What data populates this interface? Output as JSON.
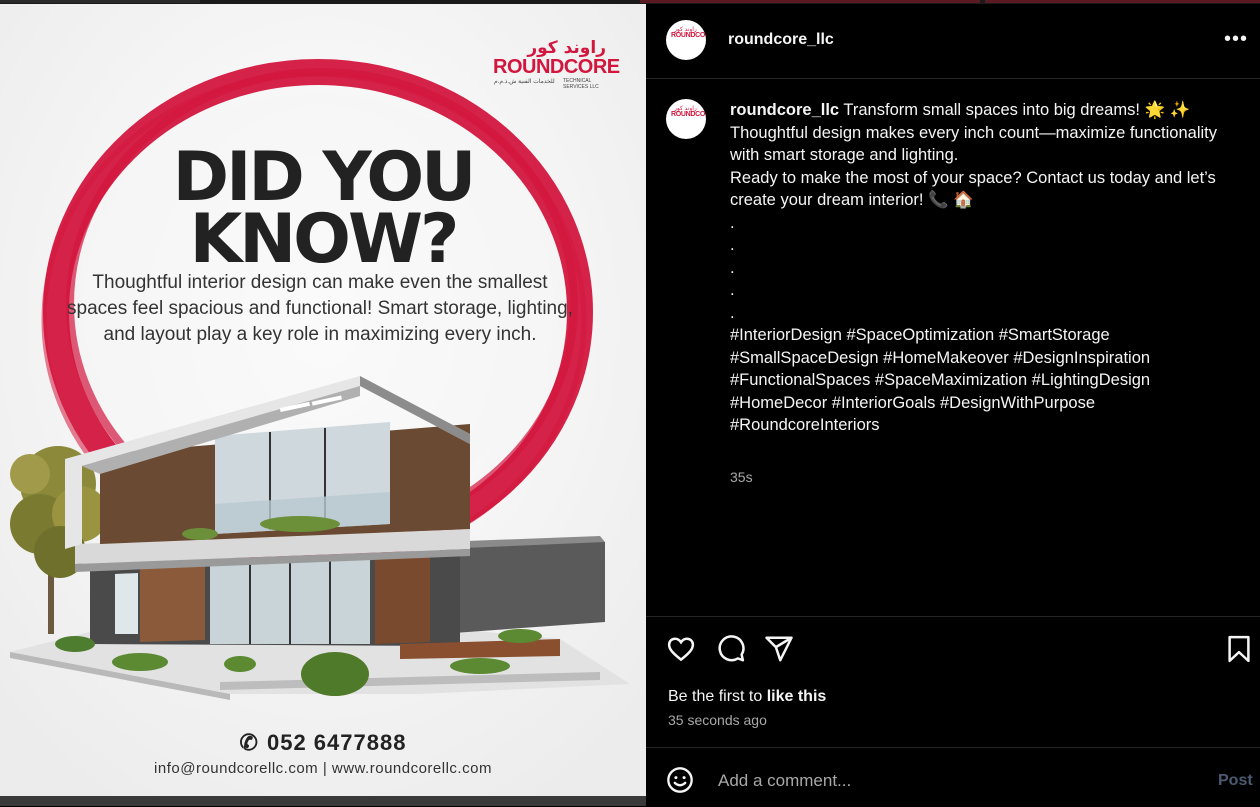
{
  "poster": {
    "logo_arabic": "راوند كور",
    "logo_round": "ROUND",
    "logo_core": "CORE",
    "logo_sub_arabic": "للخدمات الفنية ش.ذ.م.م",
    "logo_sub_english": "TECHNICAL SERVICES LLC",
    "headline_line1": "DID YOU",
    "headline_line2": "KNOW?",
    "body": "Thoughtful interior design can make even the smallest spaces feel spacious and functional! Smart storage, lighting, and layout play a key role in maximizing every inch.",
    "phone": "052 6477888",
    "contact": "info@roundcorellc.com | www.roundcorellc.com",
    "accent_color": "#d3163e"
  },
  "header": {
    "username": "roundcore_llc",
    "more_icon": "more-horizontal-icon"
  },
  "caption": {
    "username": "roundcore_llc",
    "line1": "Transform small spaces into big dreams! 🌟 ✨",
    "line2": "Thoughtful design makes every inch count—maximize functionality with smart storage and lighting.",
    "line3": "Ready to make the most of your space? Contact us today and let’s create your dream interior! 📞 🏠",
    "dots": [
      ".",
      ".",
      ".",
      ".",
      "."
    ],
    "hashtags": "#InteriorDesign #SpaceOptimization #SmartStorage #SmallSpaceDesign #HomeMakeover #DesignInspiration #FunctionalSpaces #SpaceMaximization #LightingDesign #HomeDecor #InteriorGoals #DesignWithPurpose #RoundcoreInteriors",
    "time": "35s"
  },
  "actions": {
    "like_icon": "heart-icon",
    "comment_icon": "comment-icon",
    "share_icon": "share-icon",
    "save_icon": "bookmark-icon"
  },
  "likes": {
    "prefix": "Be the first to",
    "link": "like this"
  },
  "timestamp": "35 seconds ago",
  "comment": {
    "placeholder": "Add a comment...",
    "post_label": "Post",
    "emoji_icon": "emoji-icon"
  }
}
